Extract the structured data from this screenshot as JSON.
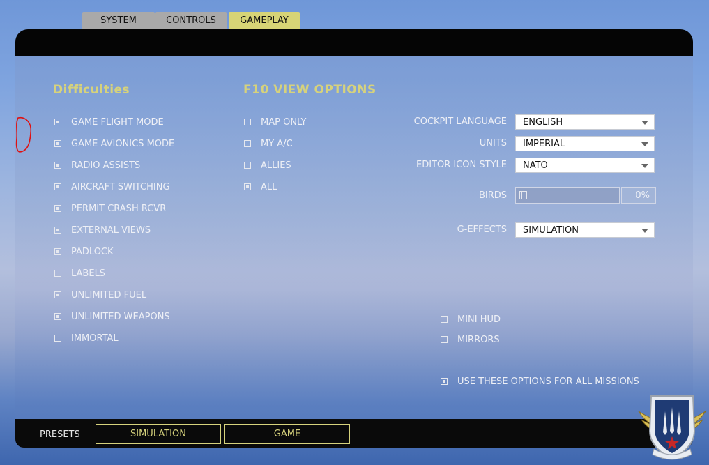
{
  "tabs": [
    {
      "label": "SYSTEM",
      "active": false
    },
    {
      "label": "CONTROLS",
      "active": false
    },
    {
      "label": "GAMEPLAY",
      "active": true
    }
  ],
  "difficulties": {
    "title": "Difficulties",
    "items": [
      {
        "label": "GAME FLIGHT MODE",
        "checked": true
      },
      {
        "label": "GAME AVIONICS MODE",
        "checked": true
      },
      {
        "label": "RADIO ASSISTS",
        "checked": true
      },
      {
        "label": "AIRCRAFT SWITCHING",
        "checked": true
      },
      {
        "label": "PERMIT CRASH RCVR",
        "checked": true
      },
      {
        "label": "EXTERNAL VIEWS",
        "checked": true
      },
      {
        "label": "PADLOCK",
        "checked": true
      },
      {
        "label": "LABELS",
        "checked": false
      },
      {
        "label": "UNLIMITED FUEL",
        "checked": true
      },
      {
        "label": "UNLIMITED WEAPONS",
        "checked": true
      },
      {
        "label": "IMMORTAL",
        "checked": false
      }
    ]
  },
  "f10": {
    "title": "F10 VIEW OPTIONS",
    "items": [
      {
        "label": "MAP ONLY",
        "checked": false
      },
      {
        "label": "MY A/C",
        "checked": false
      },
      {
        "label": "ALLIES",
        "checked": false
      },
      {
        "label": "ALL",
        "checked": true
      }
    ]
  },
  "settings": {
    "cockpit_language": {
      "label": "COCKPIT LANGUAGE",
      "value": "ENGLISH"
    },
    "units": {
      "label": "UNITS",
      "value": "IMPERIAL"
    },
    "editor_icon_style": {
      "label": "EDITOR ICON STYLE",
      "value": "NATO"
    },
    "birds": {
      "label": "BIRDS",
      "value": "0%",
      "fraction": 0
    },
    "g_effects": {
      "label": "G-EFFECTS",
      "value": "SIMULATION"
    }
  },
  "extras": [
    {
      "label": "MINI HUD",
      "checked": false
    },
    {
      "label": "MIRRORS",
      "checked": false
    }
  ],
  "use_all": {
    "label": "USE THESE OPTIONS FOR ALL MISSIONS",
    "checked": true
  },
  "presets": {
    "label": "PRESETS",
    "buttons": [
      "SIMULATION",
      "GAME"
    ]
  },
  "colors": {
    "accent": "#d6d27c",
    "active_tab": "#d7d476",
    "inactive_tab": "#a9a9a9",
    "bar": "#050505"
  }
}
